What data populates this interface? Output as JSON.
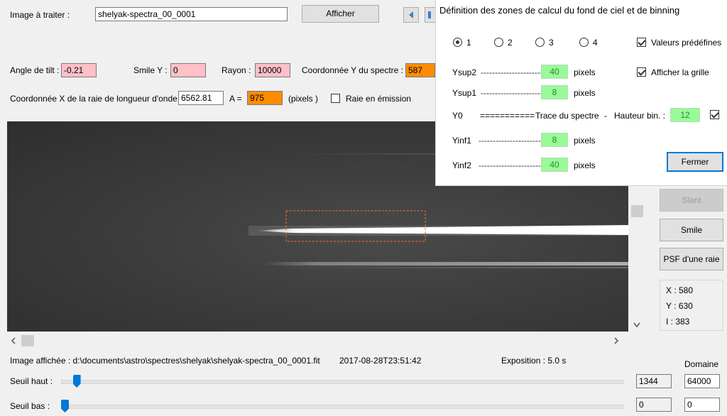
{
  "top": {
    "image_label": "Image à traiter :",
    "image_value": "shelyak-spectra_00_0001",
    "show_button": "Afficher"
  },
  "params": {
    "tilt_label": "Angle de tilt :",
    "tilt_value": "-0.21",
    "smile_label": "Smile Y :",
    "smile_value": "0",
    "rayon_label": "Rayon :",
    "rayon_value": "10000",
    "coordy_label": "Coordonnée Y du spectre :",
    "coordy_value": "587",
    "coordx_label": "Coordonnée X de la raie de longueur d'onde",
    "coordx_value": "6562.81",
    "a_label": "A =",
    "a_value": "975",
    "pixels_label": "(pixels )",
    "emission_label": "Raie en émission"
  },
  "dialog": {
    "title": "Définition des zones de calcul du fond de ciel et de binning",
    "radios": [
      "1",
      "2",
      "3",
      "4"
    ],
    "selected_radio": "1",
    "predef_label": "Valeurs prédéfines",
    "grid_label": "Afficher la grille",
    "rows": {
      "ysup2": {
        "label": "Ysup2",
        "dashes": "-----------------------",
        "value": "40",
        "unit": "pixels"
      },
      "ysup1": {
        "label": "Ysup1",
        "dashes": "-----------------------",
        "value": "8",
        "unit": "pixels"
      },
      "y0": {
        "label": "Y0",
        "dashes": "===========",
        "text": "Trace du spectre",
        "sep": "-",
        "binning_label": "Hauteur bin. :",
        "binning_value": "12"
      },
      "yinf1": {
        "label": "Yinf1",
        "dashes": "-----------------------",
        "value": "8",
        "unit": "pixels"
      },
      "yinf2": {
        "label": "Yinf2",
        "dashes": "-----------------------",
        "value": "40",
        "unit": "pixels"
      }
    },
    "close_button": "Fermer"
  },
  "side": {
    "slant_button": "Slant",
    "smile_button": "Smile",
    "psf_button": "PSF d'une raie",
    "x_readout": "X : 580",
    "y_readout": "Y : 630",
    "i_readout": "I : 383"
  },
  "bottom": {
    "image_path": "Image affichée : d:\\documents\\astro\\spectres\\shelyak\\shelyak-spectra_00_0001.fit",
    "timestamp": "2017-08-28T23:51:42",
    "exposure": "Exposition : 5.0 s",
    "domain_label": "Domaine",
    "high_label": "Seuil haut :",
    "high_value": "1344",
    "high_domain": "64000",
    "low_label": "Seuil bas :",
    "low_value": "0",
    "low_domain": "0",
    "high_level": 0.021,
    "low_level": 0.0
  },
  "colors": {
    "accent": "#0078d7",
    "roi": "#ff6a2b",
    "pink_field": "#ffc0c8",
    "orange_field": "#ff8c00",
    "green_field": "#98fb98"
  }
}
